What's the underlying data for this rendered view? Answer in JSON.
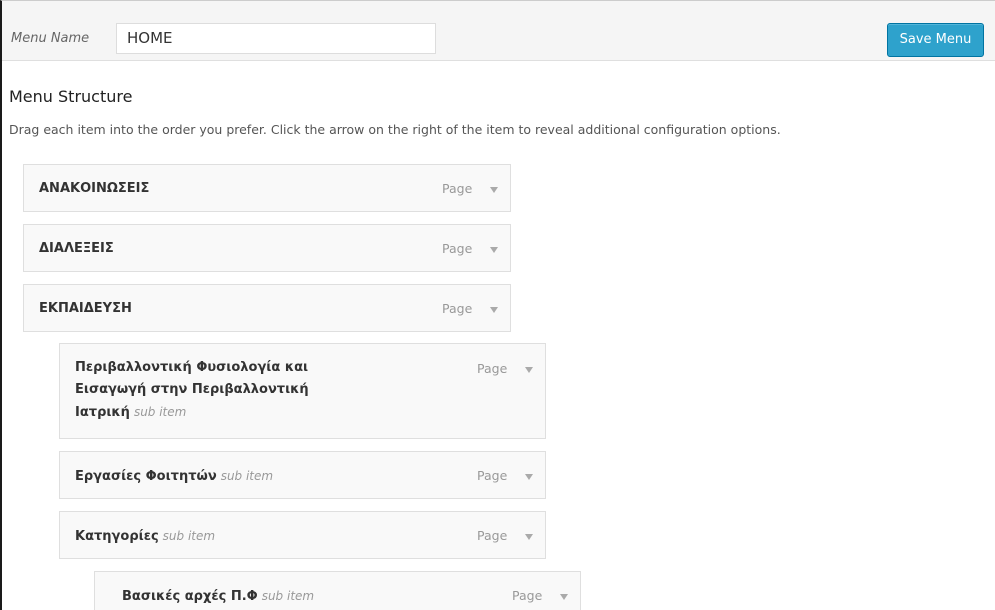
{
  "header": {
    "menu_name_label": "Menu Name",
    "menu_name_value": "HOME",
    "save_label": "Save Menu"
  },
  "structure": {
    "title": "Menu Structure",
    "instructions": "Drag each item into the order you prefer. Click the arrow on the right of the item to reveal additional configuration options."
  },
  "items": [
    {
      "title": "ΑΝΑΚΟΙΝΩΣΕΙΣ",
      "sub": "",
      "type": "Page",
      "depth": 0
    },
    {
      "title": "ΔΙΑΛΕΞΕΙΣ",
      "sub": "",
      "type": "Page",
      "depth": 0
    },
    {
      "title": "ΕΚΠΑΙΔΕΥΣΗ",
      "sub": "",
      "type": "Page",
      "depth": 0
    },
    {
      "title_lines": [
        "Περιβαλλοντική Φυσιολογία και",
        "Εισαγωγή στην Περιβαλλοντική",
        "Ιατρική"
      ],
      "sub": "sub item",
      "type": "Page",
      "depth": 1
    },
    {
      "title": "Εργασίες Φοιτητών",
      "sub": "sub item",
      "type": "Page",
      "depth": 1
    },
    {
      "title": "Κατηγορίες",
      "sub": "sub item",
      "type": "Page",
      "depth": 1
    },
    {
      "title": "Βασικές αρχές Π.Φ",
      "sub": "sub item",
      "type": "Page",
      "depth": 2
    }
  ],
  "colors": {
    "accent": "#2ea2cc",
    "item_bg": "#f9f9f9",
    "border": "#dfdfdf"
  },
  "icons": {
    "expand": "triangle-down-icon"
  }
}
